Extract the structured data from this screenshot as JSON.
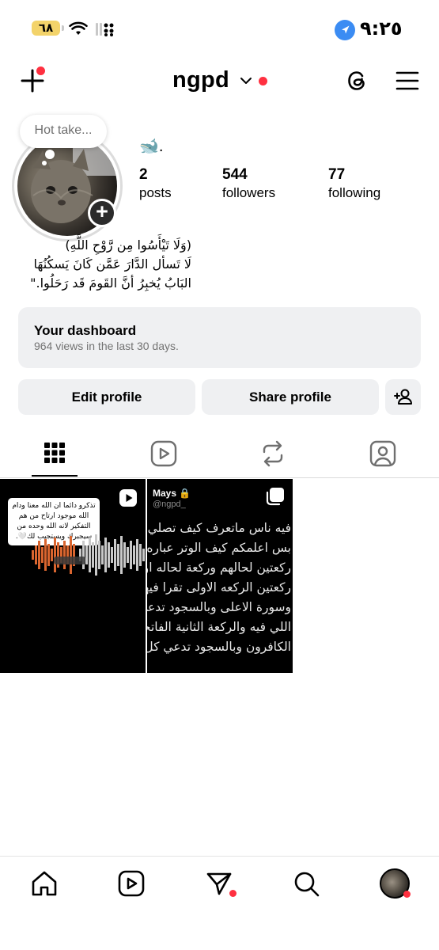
{
  "status_bar": {
    "battery": "٦٨",
    "time": "٩:٢٥"
  },
  "header": {
    "username": "ngpd",
    "icons": [
      "plus-icon",
      "chevron-down-icon",
      "threads-icon",
      "menu-icon"
    ],
    "accent_dot_color": "#ff3040"
  },
  "profile": {
    "note": "Hot take...",
    "display_name": "🐋.",
    "stats": [
      {
        "count": "2",
        "label": "posts"
      },
      {
        "count": "544",
        "label": "followers"
      },
      {
        "count": "77",
        "label": "following"
      }
    ],
    "bio": [
      "(وَلَا تَيْأَسُوا مِن رَّوْحِ اللَّهِ)",
      "لَا تَسأل الدَّارَ عَمَّن كَانَ يَسكُنُهَا",
      "البَابُ يُخبِرُ أنَّ القَومَ قَد رَحَلُوا.\""
    ]
  },
  "dashboard": {
    "title": "Your dashboard",
    "subtitle": "964 views in the last 30 days."
  },
  "buttons": {
    "edit": "Edit profile",
    "share": "Share profile"
  },
  "tabs": [
    "grid-icon",
    "reels-icon",
    "reposts-icon",
    "tagged-icon"
  ],
  "posts": [
    {
      "type": "reel",
      "note": "تذكرو دائما ان الله معنا ودام الله موجود ارتاح من هم التفكير لانه الله وحده من سيجبرك ويستجيب لك🤍."
    },
    {
      "type": "carousel",
      "author": "Mays 🔒",
      "handle": "@ngpd_",
      "lines": [
        "فيه ناس ماتعرف كيف تصلي الوتر",
        "بس اعلمكم كيف الوتر عباره عن ثلاث",
        "ركعتين لحالهم وركعة لحاله اول",
        "ركعتين الركعه الاولى تقرا فيها الفاتحة",
        "وسورة الاعلى وبالسجود تدعي الله",
        "اللي فيه والركعة الثانية الفاتحة بعدها",
        "الكافرون وبالسجود تدعي كل شي"
      ]
    }
  ]
}
